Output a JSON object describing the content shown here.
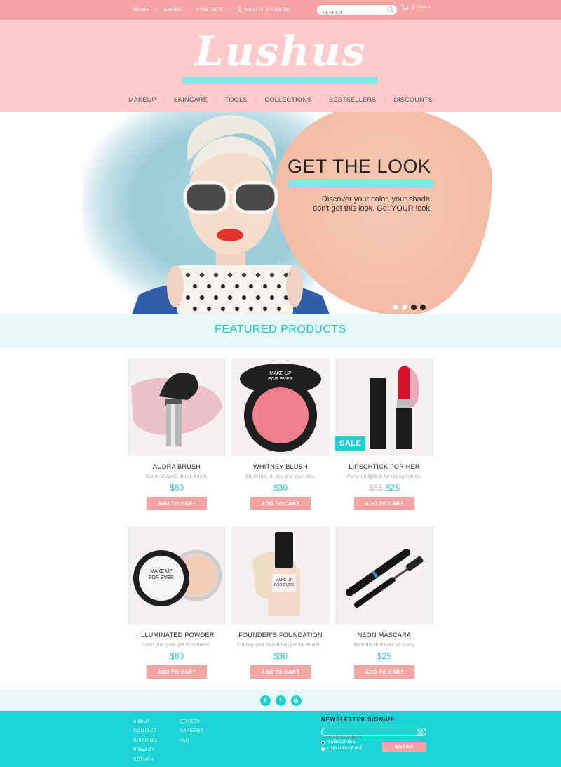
{
  "topbar": {
    "links": [
      "HOME",
      "ABOUT",
      "CONTACT"
    ],
    "greeting": "HELLO, CHANTAL",
    "search_placeholder": "SEARCH",
    "cart_count": "5",
    "cart_label": "Items"
  },
  "header": {
    "logo": "Lushus",
    "nav": [
      "MAKEUP",
      "SKINCARE",
      "TOOLS",
      "COLLECTIONS",
      "BESTSELLERS",
      "DISCOUNTS"
    ]
  },
  "hero": {
    "title": "GET THE LOOK",
    "subtitle_line1": "Discover your color, your shade,",
    "subtitle_line2": "don't get this look. Get YOUR look!",
    "slide_count": 4,
    "active_slides": [
      2,
      3
    ]
  },
  "featured": {
    "title": "FEATURED PRODUCTS",
    "products": [
      {
        "name": "AUDRA BRUSH",
        "desc": "Dome-shaped, dense brush.",
        "price": "$80",
        "old_price": "",
        "sale": false,
        "button": "ADD TO CART"
      },
      {
        "name": "WHITNEY BLUSH",
        "desc": "Blush just for you and your skin.",
        "price": "$30",
        "old_price": "",
        "sale": false,
        "button": "ADD TO CART"
      },
      {
        "name": "LIPSCHTICK FOR HER",
        "desc": "Fiery red lipstick for taking names.",
        "price": "$25",
        "old_price": "$55",
        "sale": true,
        "sale_label": "SALE",
        "button": "ADD TO CART"
      },
      {
        "name": "ILLUMINATED POWDER",
        "desc": "Don't just glow, get illuminated.",
        "price": "$80",
        "old_price": "",
        "sale": false,
        "button": "ADD TO CART"
      },
      {
        "name": "FOUNDER'S FOUNDATION",
        "desc": "Finding your foundation just for easier...",
        "price": "$30",
        "old_price": "",
        "sale": false,
        "button": "ADD TO CART"
      },
      {
        "name": "NEON MASCARA",
        "desc": "Mascara that's not so scary.",
        "price": "$25",
        "old_price": "",
        "sale": false,
        "button": "ADD TO CART"
      }
    ]
  },
  "social": {
    "icons": [
      "facebook-icon",
      "twitter-icon",
      "instagram-icon"
    ],
    "glyphs": [
      "f",
      "t",
      "◎"
    ]
  },
  "footer": {
    "col1": [
      "ABOUT",
      "CONTACT",
      "SHIPPING",
      "PRIVACY",
      "RETURN"
    ],
    "col2": [
      "STORES",
      "CAREERS",
      "FAQ"
    ],
    "newsletter_title": "NEWSLETTER SIGN-UP",
    "email_placeholder": "EMAIL ADDRESS",
    "subscribe": "SUBSCRIBE",
    "unsubscribe": "UNSUBSCRIBE",
    "enter": "ENTER"
  },
  "colors": {
    "pink": "#f7a4a4",
    "light_pink": "#fccaca",
    "teal": "#1ed3d3",
    "aqua_bar": "#7de8e8"
  }
}
